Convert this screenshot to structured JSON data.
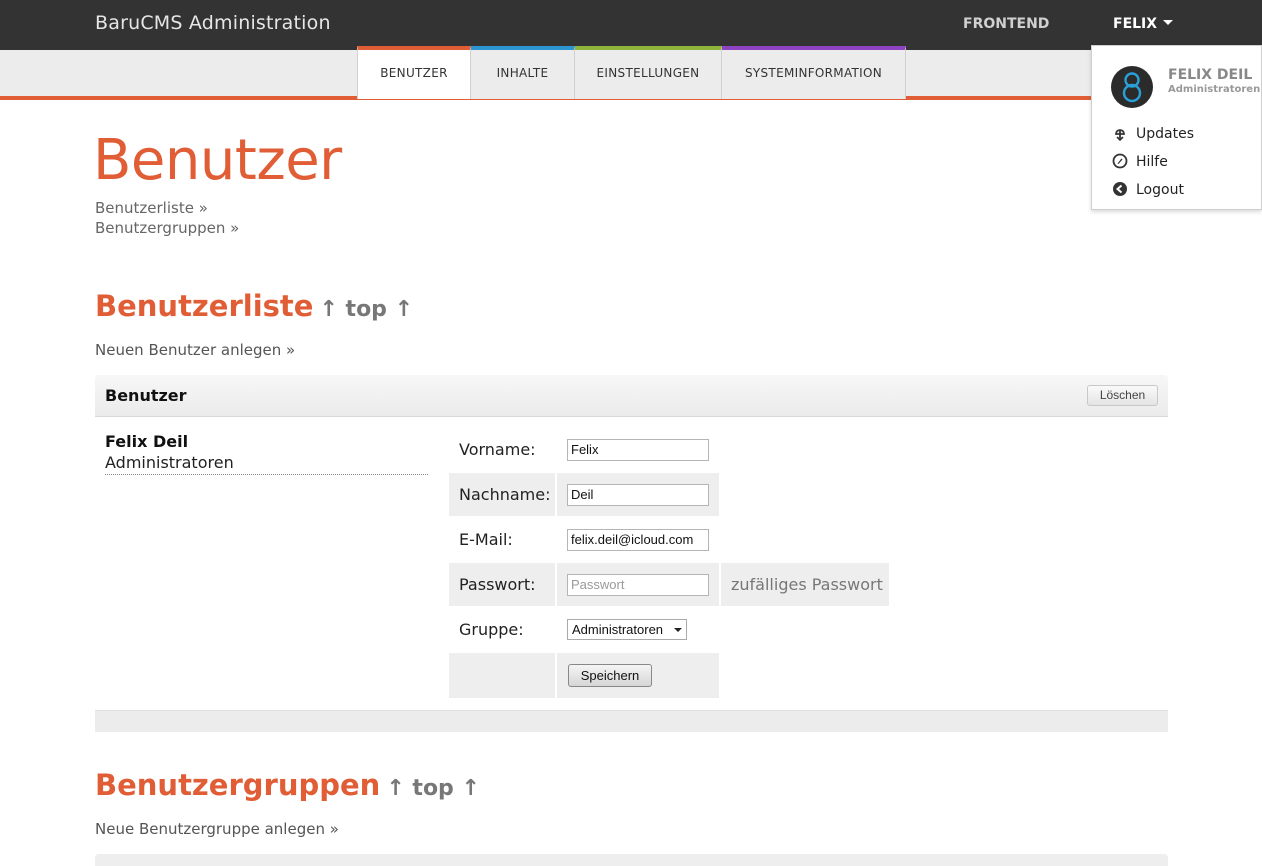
{
  "app": {
    "title": "BaruCMS Administration"
  },
  "topbar": {
    "frontend_label": "FRONTEND",
    "user_label": "FELIX"
  },
  "nav": {
    "tabs": [
      {
        "label": "BENUTZER",
        "color": "#e05d35",
        "active": true
      },
      {
        "label": "INHALTE",
        "color": "#2e95d3",
        "active": false
      },
      {
        "label": "EINSTELLUNGEN",
        "color": "#8db33a",
        "active": false
      },
      {
        "label": "SYSTEMINFORMATION",
        "color": "#8e44c2",
        "active": false
      }
    ]
  },
  "dropdown": {
    "name": "FELIX DEIL",
    "group": "Administratoren",
    "items": [
      {
        "label": "Updates",
        "icon": "updates-icon"
      },
      {
        "label": "Hilfe",
        "icon": "help-icon"
      },
      {
        "label": "Logout",
        "icon": "logout-icon"
      }
    ]
  },
  "page": {
    "title": "Benutzer",
    "anchors": [
      "Benutzerliste »",
      "Benutzergruppen »"
    ]
  },
  "users_section": {
    "title": "Benutzerliste",
    "top_link": "↑ top ↑",
    "new_link": "Neuen Benutzer anlegen »",
    "card": {
      "header": "Benutzer",
      "delete_label": "Löschen",
      "user_name": "Felix Deil",
      "user_group": "Administratoren",
      "form": {
        "firstname_label": "Vorname:",
        "firstname_value": "Felix",
        "lastname_label": "Nachname:",
        "lastname_value": "Deil",
        "email_label": "E-Mail:",
        "email_value": "felix.deil@icloud.com",
        "password_label": "Passwort:",
        "password_placeholder": "Passwort",
        "random_password_label": "zufälliges Passwort",
        "group_label": "Gruppe:",
        "group_selected": "Administratoren",
        "save_label": "Speichern"
      }
    }
  },
  "groups_section": {
    "title": "Benutzergruppen",
    "top_link": "↑ top ↑",
    "new_link": "Neue Benutzergruppe anlegen »"
  },
  "colors": {
    "accent": "#e05d35",
    "topbar": "#333333"
  }
}
